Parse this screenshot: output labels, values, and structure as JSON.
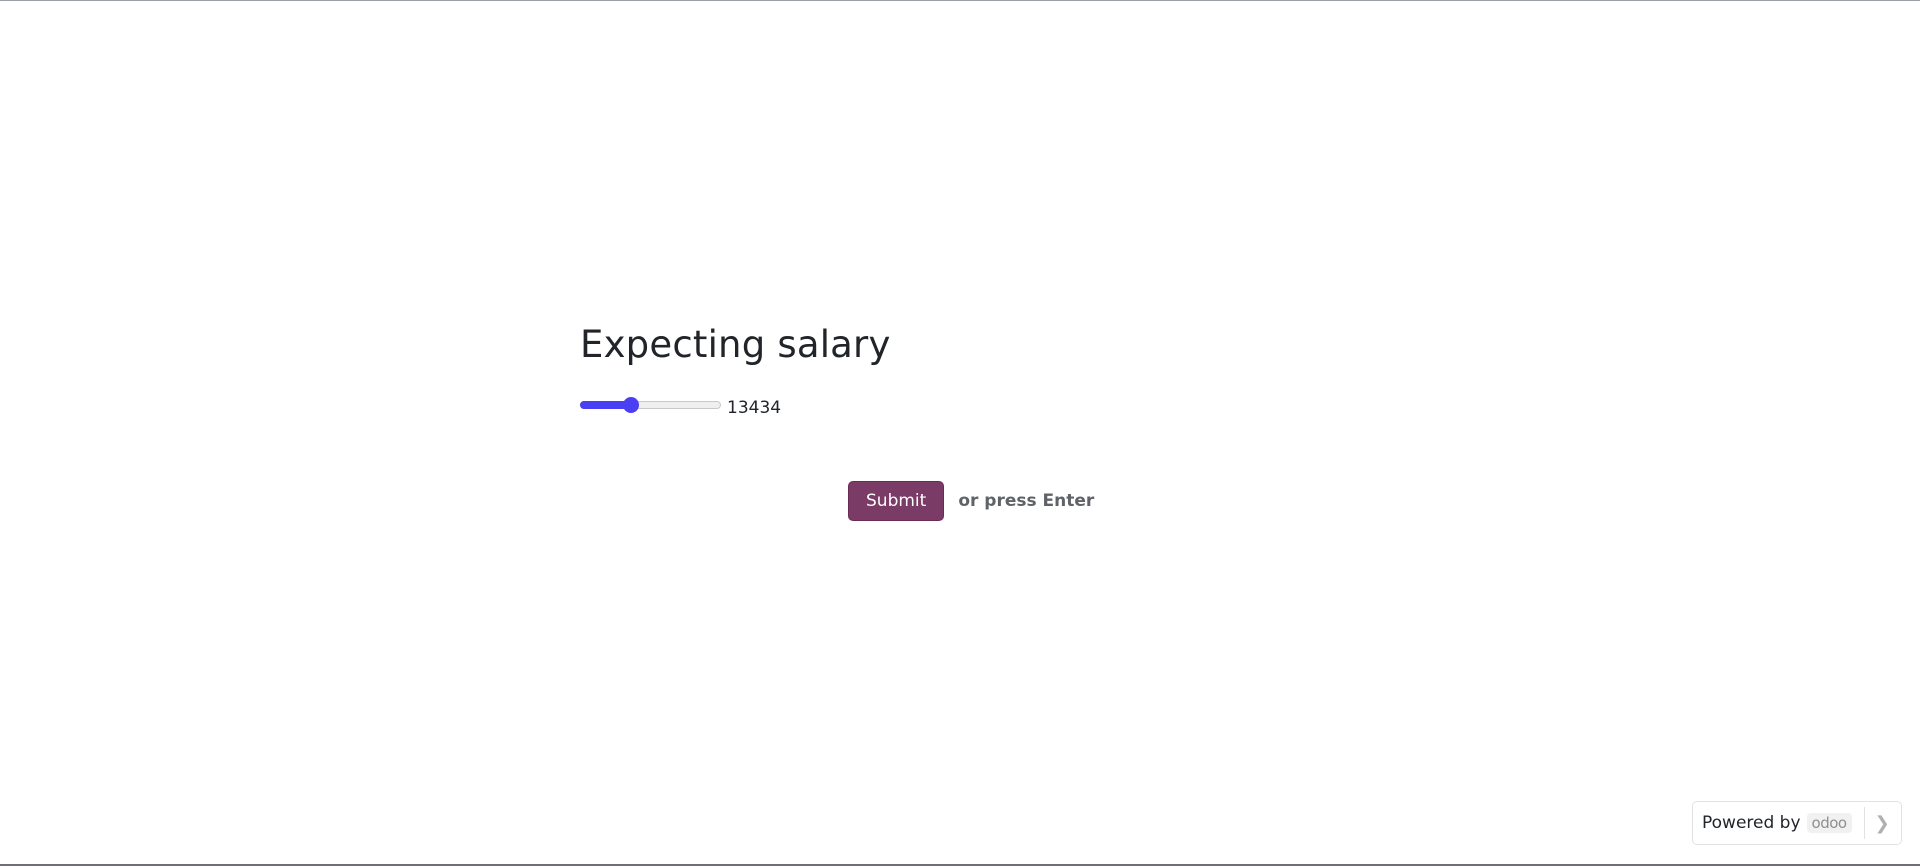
{
  "question": {
    "title": "Expecting salary"
  },
  "slider": {
    "value": "13434",
    "fill_fraction": 0.36,
    "accent_color": "#4a3ff2"
  },
  "actions": {
    "submit_label": "Submit",
    "hint": "or press Enter",
    "submit_color": "#7b3b67"
  },
  "footer": {
    "powered_label": "Powered by",
    "logo_text": "odoo",
    "next_icon": "chevron-right-icon"
  }
}
